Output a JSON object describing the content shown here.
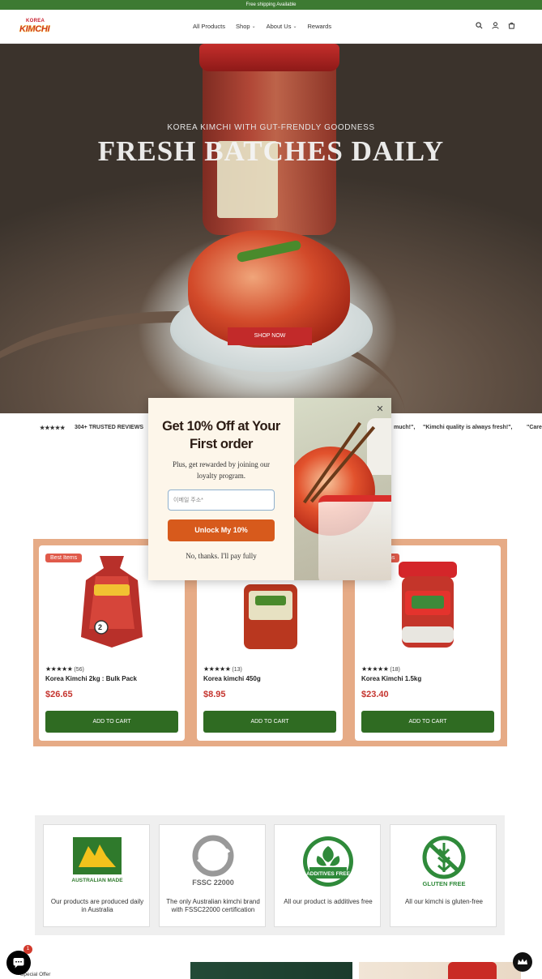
{
  "announcement": "Free shipping Available",
  "brand": {
    "line1": "KOREA",
    "line2": "KIMCHI"
  },
  "nav": {
    "items": [
      {
        "label": "All Products",
        "dropdown": false
      },
      {
        "label": "Shop",
        "dropdown": true
      },
      {
        "label": "About Us",
        "dropdown": true
      },
      {
        "label": "Rewards",
        "dropdown": false
      }
    ],
    "chevron": "⌄"
  },
  "hero": {
    "subtitle": "KOREA KIMCHI WITH GUT-FRENDLY GOODNESS",
    "title": "FRESH BATCHES DAILY",
    "cta": "SHOP NOW"
  },
  "reviews_marquee": {
    "stars": "★★★★★",
    "trusted": "304+ TRUSTED REVIEWS",
    "quote1": "much!\",",
    "quote2": "\"Kimchi quality is always fresh!\",",
    "quote3": "\"Care"
  },
  "popup": {
    "title": "Get 10% Off at Your First order",
    "description": "Plus, get rewarded by joining our loyalty program.",
    "email_placeholder": "이메일 주소*",
    "cta": "Unlock My 10%",
    "decline": "No, thanks. I'll pay fully",
    "close": "✕"
  },
  "products": [
    {
      "badge": "Best Items",
      "stars": "★★★★★",
      "reviews": "(56)",
      "name": "Korea Kimchi 2kg : Bulk Pack",
      "price": "$26.65",
      "cta": "ADD TO CART"
    },
    {
      "badge": "",
      "stars": "★★★★★",
      "reviews": "(13)",
      "name": "Korea kimchi 450g",
      "price": "$8.95",
      "cta": "ADD TO CART"
    },
    {
      "badge": "ms",
      "stars": "★★★★★",
      "reviews": "(18)",
      "name": "Korea Kimchi 1.5kg",
      "price": "$23.40",
      "cta": "ADD TO CART"
    }
  ],
  "features": [
    {
      "icon": "australian-made-logo",
      "badge_text": "AUSTRALIAN MADE",
      "text": "Our products are produced daily in Australia"
    },
    {
      "icon": "fssc-22000-logo",
      "badge_text": "FSSC 22000",
      "text": "The only Australian kimchi brand with FSSC22000 certification"
    },
    {
      "icon": "additives-free-logo",
      "badge_text": "ADDITIVES FREE",
      "text": "All our product is additives free"
    },
    {
      "icon": "gluten-free-logo",
      "badge_text": "GLUTEN FREE",
      "text": "All our kimchi is gluten-free"
    }
  ],
  "bottom": {
    "special_offer": "Special Offer",
    "chat_badge": "1"
  },
  "colors": {
    "announcement_bg": "#3d7a32",
    "brand_red": "#c22a2a",
    "add_to_cart": "#2f6b22",
    "popup_cta": "#d75a1c",
    "products_bg": "#e6ab86",
    "price": "#c5352f"
  }
}
